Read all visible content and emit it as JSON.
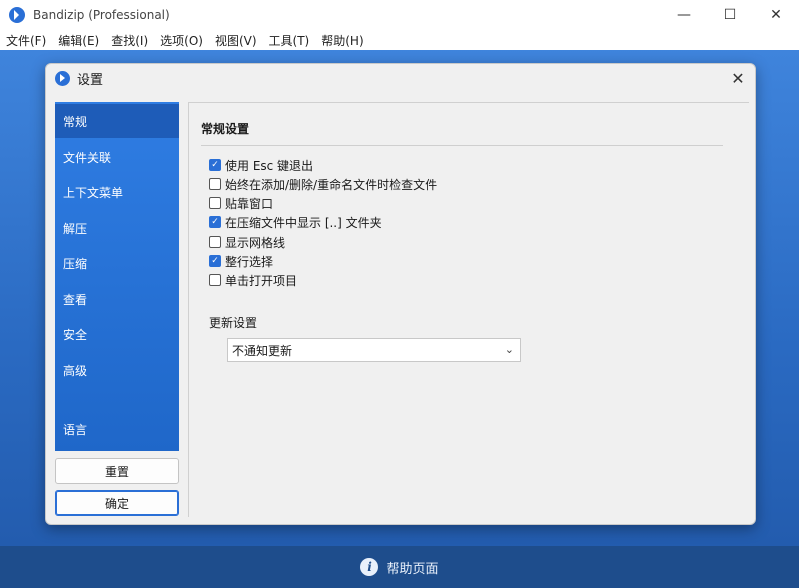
{
  "window": {
    "title": "Bandizip (Professional)",
    "controls": {
      "minimize": "—",
      "maximize": "☐",
      "close": "✕"
    }
  },
  "menu": [
    "文件(F)",
    "编辑(E)",
    "查找(I)",
    "选项(O)",
    "视图(V)",
    "工具(T)",
    "帮助(H)"
  ],
  "dialog": {
    "title": "设置",
    "close": "✕",
    "sidebar": [
      "常规",
      "文件关联",
      "上下文菜单",
      "解压",
      "压缩",
      "查看",
      "安全",
      "高级",
      "语言"
    ],
    "active_item": "常规",
    "reset_label": "重置",
    "ok_label": "确定",
    "section_title": "常规设置",
    "options": [
      {
        "label": "使用 Esc 键退出",
        "checked": true
      },
      {
        "label": "始终在添加/删除/重命名文件时检查文件",
        "checked": false
      },
      {
        "label": "贴靠窗口",
        "checked": false
      },
      {
        "label": "在压缩文件中显示 [..] 文件夹",
        "checked": true
      },
      {
        "label": "显示网格线",
        "checked": false
      },
      {
        "label": "整行选择",
        "checked": true
      },
      {
        "label": "单击打开项目",
        "checked": false
      }
    ],
    "update_label": "更新设置",
    "update_value": "不通知更新"
  },
  "help_bar": {
    "label": "帮助页面",
    "icon": "i"
  },
  "colors": {
    "accent": "#2a6fd6",
    "sidebar": "#2f7de3",
    "help_bar": "#1e4d8c"
  }
}
